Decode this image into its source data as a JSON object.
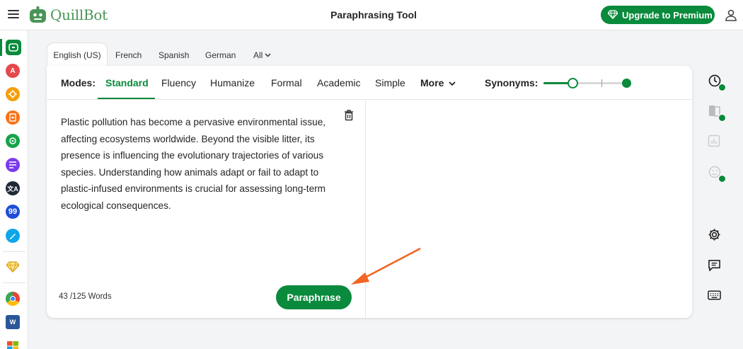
{
  "app": {
    "logo_text": "QuillBot",
    "page_title": "Paraphrasing Tool",
    "upgrade_label": "Upgrade to Premium"
  },
  "language_tabs": [
    {
      "label": "English (US)",
      "active": true
    },
    {
      "label": "French"
    },
    {
      "label": "Spanish"
    },
    {
      "label": "German"
    },
    {
      "label": "All"
    }
  ],
  "modes": {
    "label": "Modes:",
    "items": [
      "Standard",
      "Fluency",
      "Humanize",
      "Formal",
      "Academic",
      "Simple"
    ],
    "active": "Standard",
    "more_label": "More",
    "synonyms_label": "Synonyms:",
    "synonyms_level": 0.3
  },
  "editor": {
    "input_text": "Plastic pollution has become a pervasive environmental issue, affecting ecosystems worldwide. Beyond the visible litter, its presence is influencing the evolutionary trajectories of various species. Understanding how animals adapt or fail to adapt to plastic-infused environments is crucial for assessing long-term ecological consequences.",
    "word_count": "43 /125 Words",
    "paraphrase_label": "Paraphrase"
  },
  "sidebar_icons": [
    "paraphraser-icon",
    "grammar-checker-icon",
    "ai-detector-icon",
    "plagiarism-checker-icon",
    "ai-humanizer-icon",
    "summarizer-icon",
    "translator-icon",
    "citation-generator-icon",
    "ai-writer-icon",
    "premium-icon",
    "chrome-icon",
    "word-icon",
    "windows-icon"
  ],
  "right_rail_icons": [
    "history-icon",
    "compare-icon",
    "statistics-icon",
    "tone-icon",
    "settings-icon",
    "feedback-icon",
    "keyboard-icon"
  ],
  "colors": {
    "brand_green": "#098a3c",
    "annotation_arrow": "#f26522"
  }
}
